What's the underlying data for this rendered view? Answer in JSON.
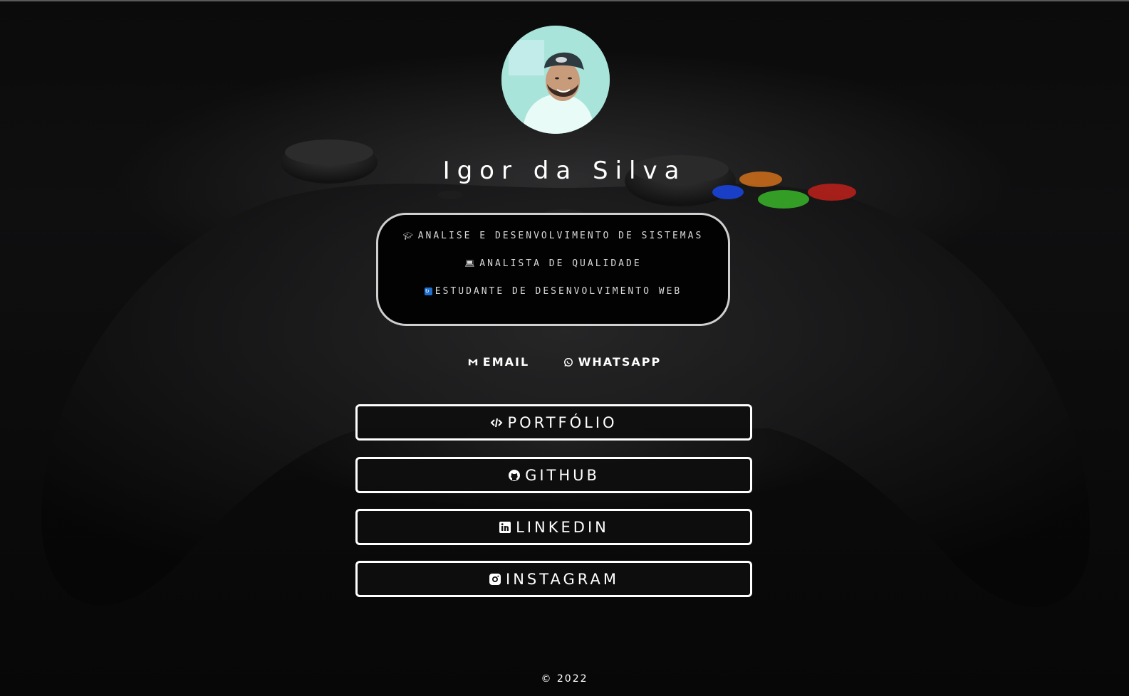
{
  "profile": {
    "name": "Igor da Silva"
  },
  "info": {
    "line1": "ANALISE E DESENVOLVIMENTO DE SISTEMAS",
    "line2": "ANALISTA DE QUALIDADE",
    "line3": "ESTUDANTE DE DESENVOLVIMENTO WEB"
  },
  "contacts": {
    "email": "EMAIL",
    "whatsapp": "WHATSAPP"
  },
  "links": {
    "portfolio": "PORTFÓLIO",
    "github": "GITHUB",
    "linkedin": "LINKEDIN",
    "instagram": "INSTAGRAM"
  },
  "footer": {
    "copyright": "© 2022"
  },
  "colors": {
    "background": "#050505",
    "text": "#ffffff",
    "border": "#ffffff",
    "avatar_bg": "#8fd8cc",
    "button_a": "#1a47e6",
    "button_b": "#e87a1a",
    "button_x": "#3bbf2a",
    "button_y": "#c9201b"
  }
}
